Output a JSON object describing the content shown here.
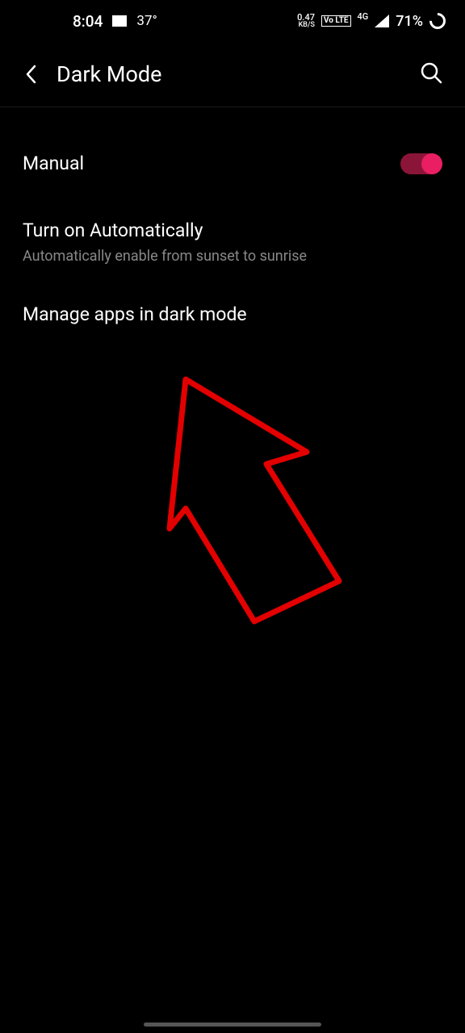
{
  "statusBar": {
    "time": "8:04",
    "temperature": "37°",
    "dataRate": "0.47",
    "dataRateUnit": "KB/S",
    "volte": "Vo LTE",
    "network": "4G",
    "battery": "71%"
  },
  "appBar": {
    "title": "Dark Mode"
  },
  "settings": {
    "manual": {
      "label": "Manual",
      "enabled": true
    },
    "auto": {
      "title": "Turn on Automatically",
      "subtitle": "Automatically enable from sunset to sunrise"
    },
    "manageApps": {
      "title": "Manage apps in dark mode"
    }
  }
}
